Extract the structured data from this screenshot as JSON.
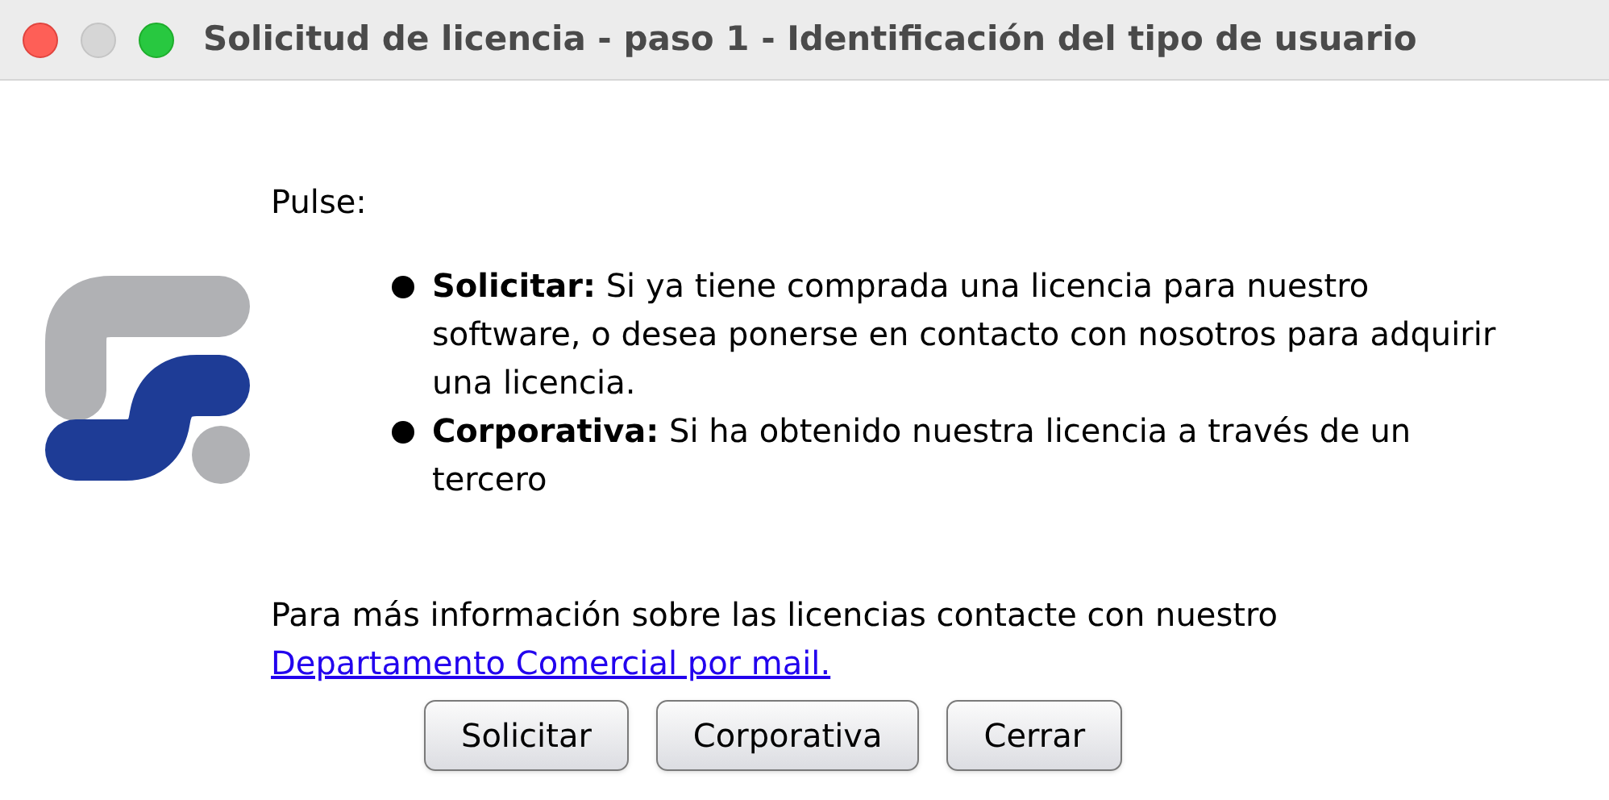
{
  "window": {
    "title": "Solicitud de licencia - paso 1 - Identificación del tipo de usuario"
  },
  "intro": "Pulse:",
  "options": [
    {
      "text": "**Solicitar:** Si ya tiene comprada una licencia para nuestro software, o desea ponerse en contacto con nosotros para adquirir una licencia."
    },
    {
      "text": "**Corporativa:** Si ha obtenido nuestra licencia a través de un tercero"
    }
  ],
  "info": {
    "text": "Para más información sobre las licencias contacte con nuestro",
    "link": "Departamento Comercial por mail."
  },
  "buttons": [
    "Solicitar",
    "Corporativa",
    "Cerrar"
  ]
}
